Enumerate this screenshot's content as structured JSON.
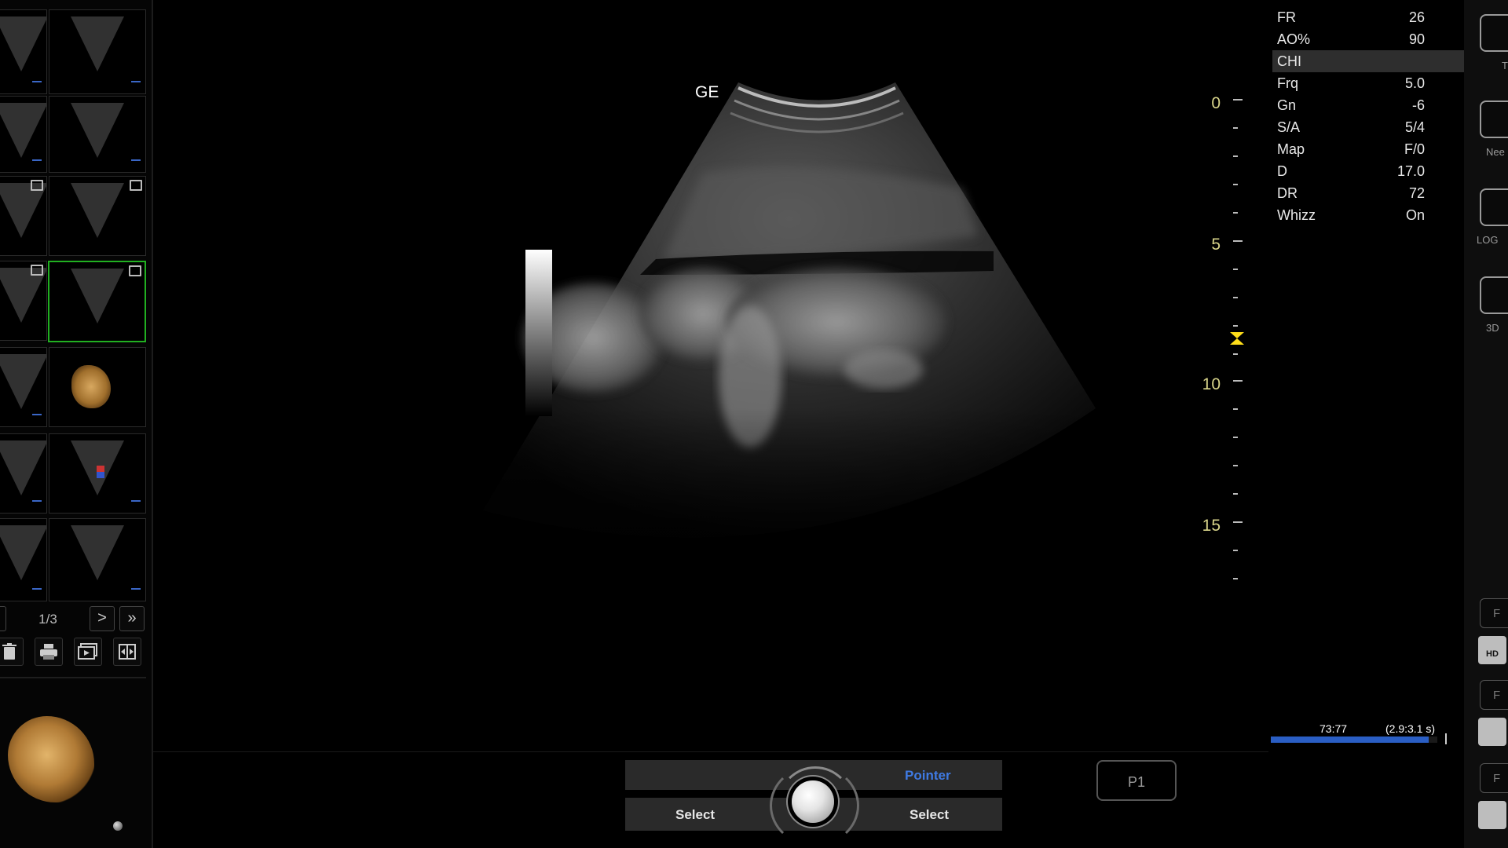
{
  "image": {
    "probe_label": "GE"
  },
  "depth_scale": {
    "labels": [
      "0",
      "5",
      "10",
      "15"
    ],
    "focus_marker_icon": "focus-hourglass-icon"
  },
  "params": [
    {
      "name": "FR",
      "value": "26"
    },
    {
      "name": "AO%",
      "value": "90"
    },
    {
      "name": "CHI",
      "value": ""
    },
    {
      "name": "Frq",
      "value": "5.0"
    },
    {
      "name": "Gn",
      "value": "-6"
    },
    {
      "name": "S/A",
      "value": "5/4"
    },
    {
      "name": "Map",
      "value": "F/0"
    },
    {
      "name": "D",
      "value": "17.0"
    },
    {
      "name": "DR",
      "value": "72"
    },
    {
      "name": "Whizz",
      "value": "On"
    }
  ],
  "thumbnails": {
    "pager": {
      "indicator": "1/3",
      "next_icon": ">",
      "last_icon": "»"
    },
    "tools": [
      "trash-icon",
      "print-icon",
      "clip-icon",
      "compare-icon"
    ]
  },
  "right_strip": {
    "labels": [
      "T",
      "Nee",
      "LOGI",
      "3D"
    ],
    "small_buttons": [
      "F",
      "F",
      "F"
    ],
    "hd_label": "HD"
  },
  "cine": {
    "frame": "73:77",
    "range": "(2.9:3.1 s)",
    "progress": 0.95
  },
  "bottom": {
    "pointer_label": "Pointer",
    "select_left": "Select",
    "select_right": "Select",
    "p1_label": "P1"
  },
  "colors": {
    "selected_thumb_border": "#21b021",
    "depth_label": "#d8d48a",
    "focus_marker": "#ffde1a",
    "pointer_text": "#3f7ae3",
    "cine_fill": "#2a5ec4"
  }
}
